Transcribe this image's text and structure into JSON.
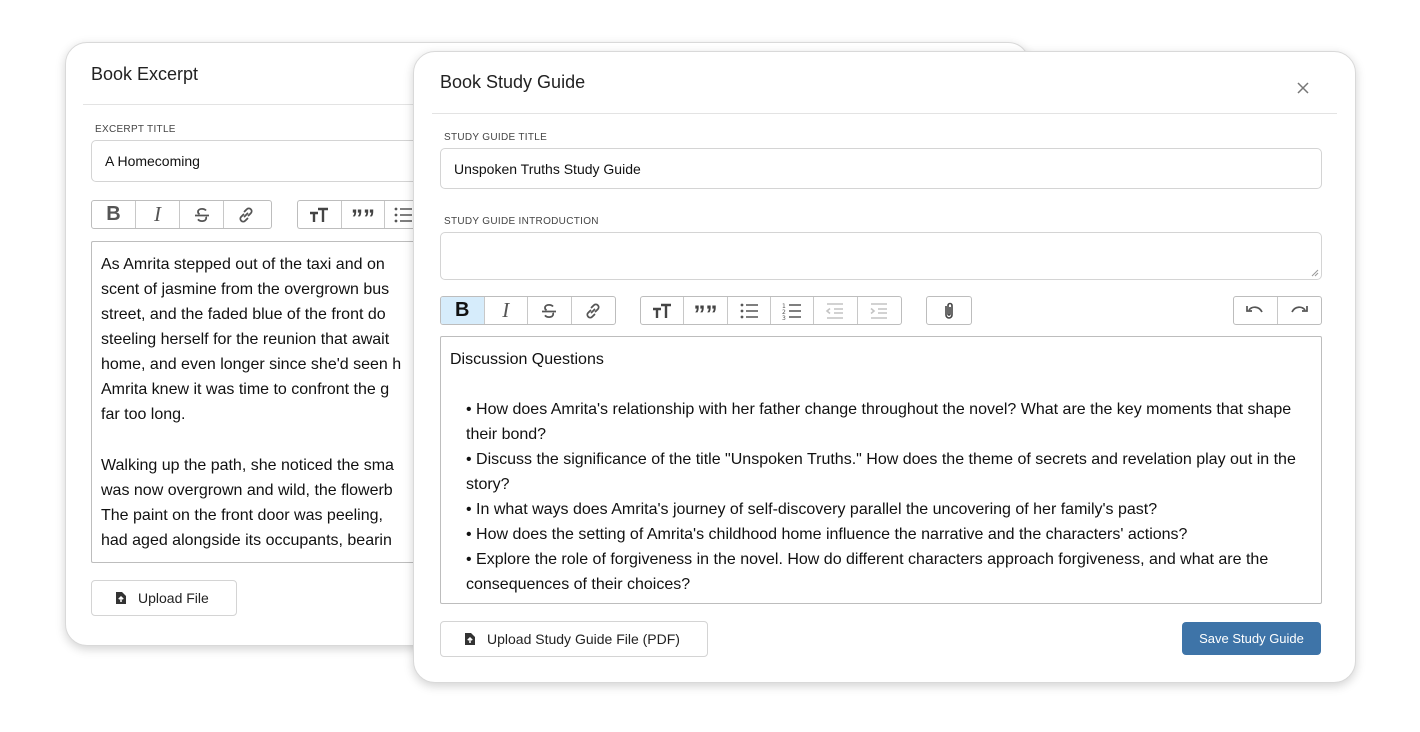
{
  "back_dialog": {
    "title": "Book Excerpt",
    "excerpt_title_label": "EXCERPT TITLE",
    "excerpt_title_value": "A Homecoming",
    "toolbar": {
      "format_group": [
        "bold-icon",
        "italic-icon",
        "strikethrough-icon",
        "link-icon"
      ],
      "block_group": [
        "text-size-icon",
        "quote-icon",
        "bulleted-list-icon"
      ]
    },
    "body_paragraphs": [
      [
        "As Amrita stepped out of the taxi and on",
        "scent of jasmine from the overgrown bus",
        "street, and the faded blue of the front do",
        "steeling herself for the reunion that await",
        "home, and even longer since she'd seen h",
        "Amrita knew it was time to confront the g",
        "far too long."
      ],
      [
        "Walking up the path, she noticed the sma",
        "was now overgrown and wild, the flowerb",
        "The paint on the front door was peeling, ",
        "had aged alongside its occupants, bearin"
      ]
    ],
    "upload_label": "Upload File"
  },
  "front_dialog": {
    "title": "Book Study Guide",
    "close_icon": "close-icon",
    "study_title_label": "STUDY GUIDE TITLE",
    "study_title_value": "Unspoken Truths Study Guide",
    "intro_label": "STUDY GUIDE INTRODUCTION",
    "intro_value": "",
    "toolbar": {
      "format_group": [
        "bold-icon (active)",
        "italic-icon",
        "strikethrough-icon",
        "link-icon"
      ],
      "block_group": [
        "text-size-icon",
        "quote-icon",
        "bulleted-list-icon",
        "numbered-list-icon",
        "outdent-icon (disabled)",
        "indent-icon (disabled)"
      ],
      "attach": "paperclip-icon",
      "history_group": [
        "undo-icon",
        "redo-icon"
      ]
    },
    "editor": {
      "heading": "Discussion Questions",
      "questions": [
        "• How does Amrita's relationship with her father change throughout the novel? What are the key moments that shape their bond?",
        "• Discuss the significance of the title \"Unspoken Truths.\" How does the theme of secrets and revelation play out in the story?",
        "• In what ways does Amrita's journey of self-discovery parallel the uncovering of her family's past?",
        "• How does the setting of Amrita's childhood home influence the narrative and the characters' actions?",
        "• Explore the role of forgiveness in the novel. How do different characters approach forgiveness, and what are the consequences of their choices?"
      ]
    },
    "upload_label": "Upload Study Guide File (PDF)",
    "save_label": "Save Study Guide"
  },
  "colors": {
    "primary_button": "#3e74a8",
    "active_toolbar_button": "#d6ecfb",
    "border": "#d4d4d4"
  }
}
